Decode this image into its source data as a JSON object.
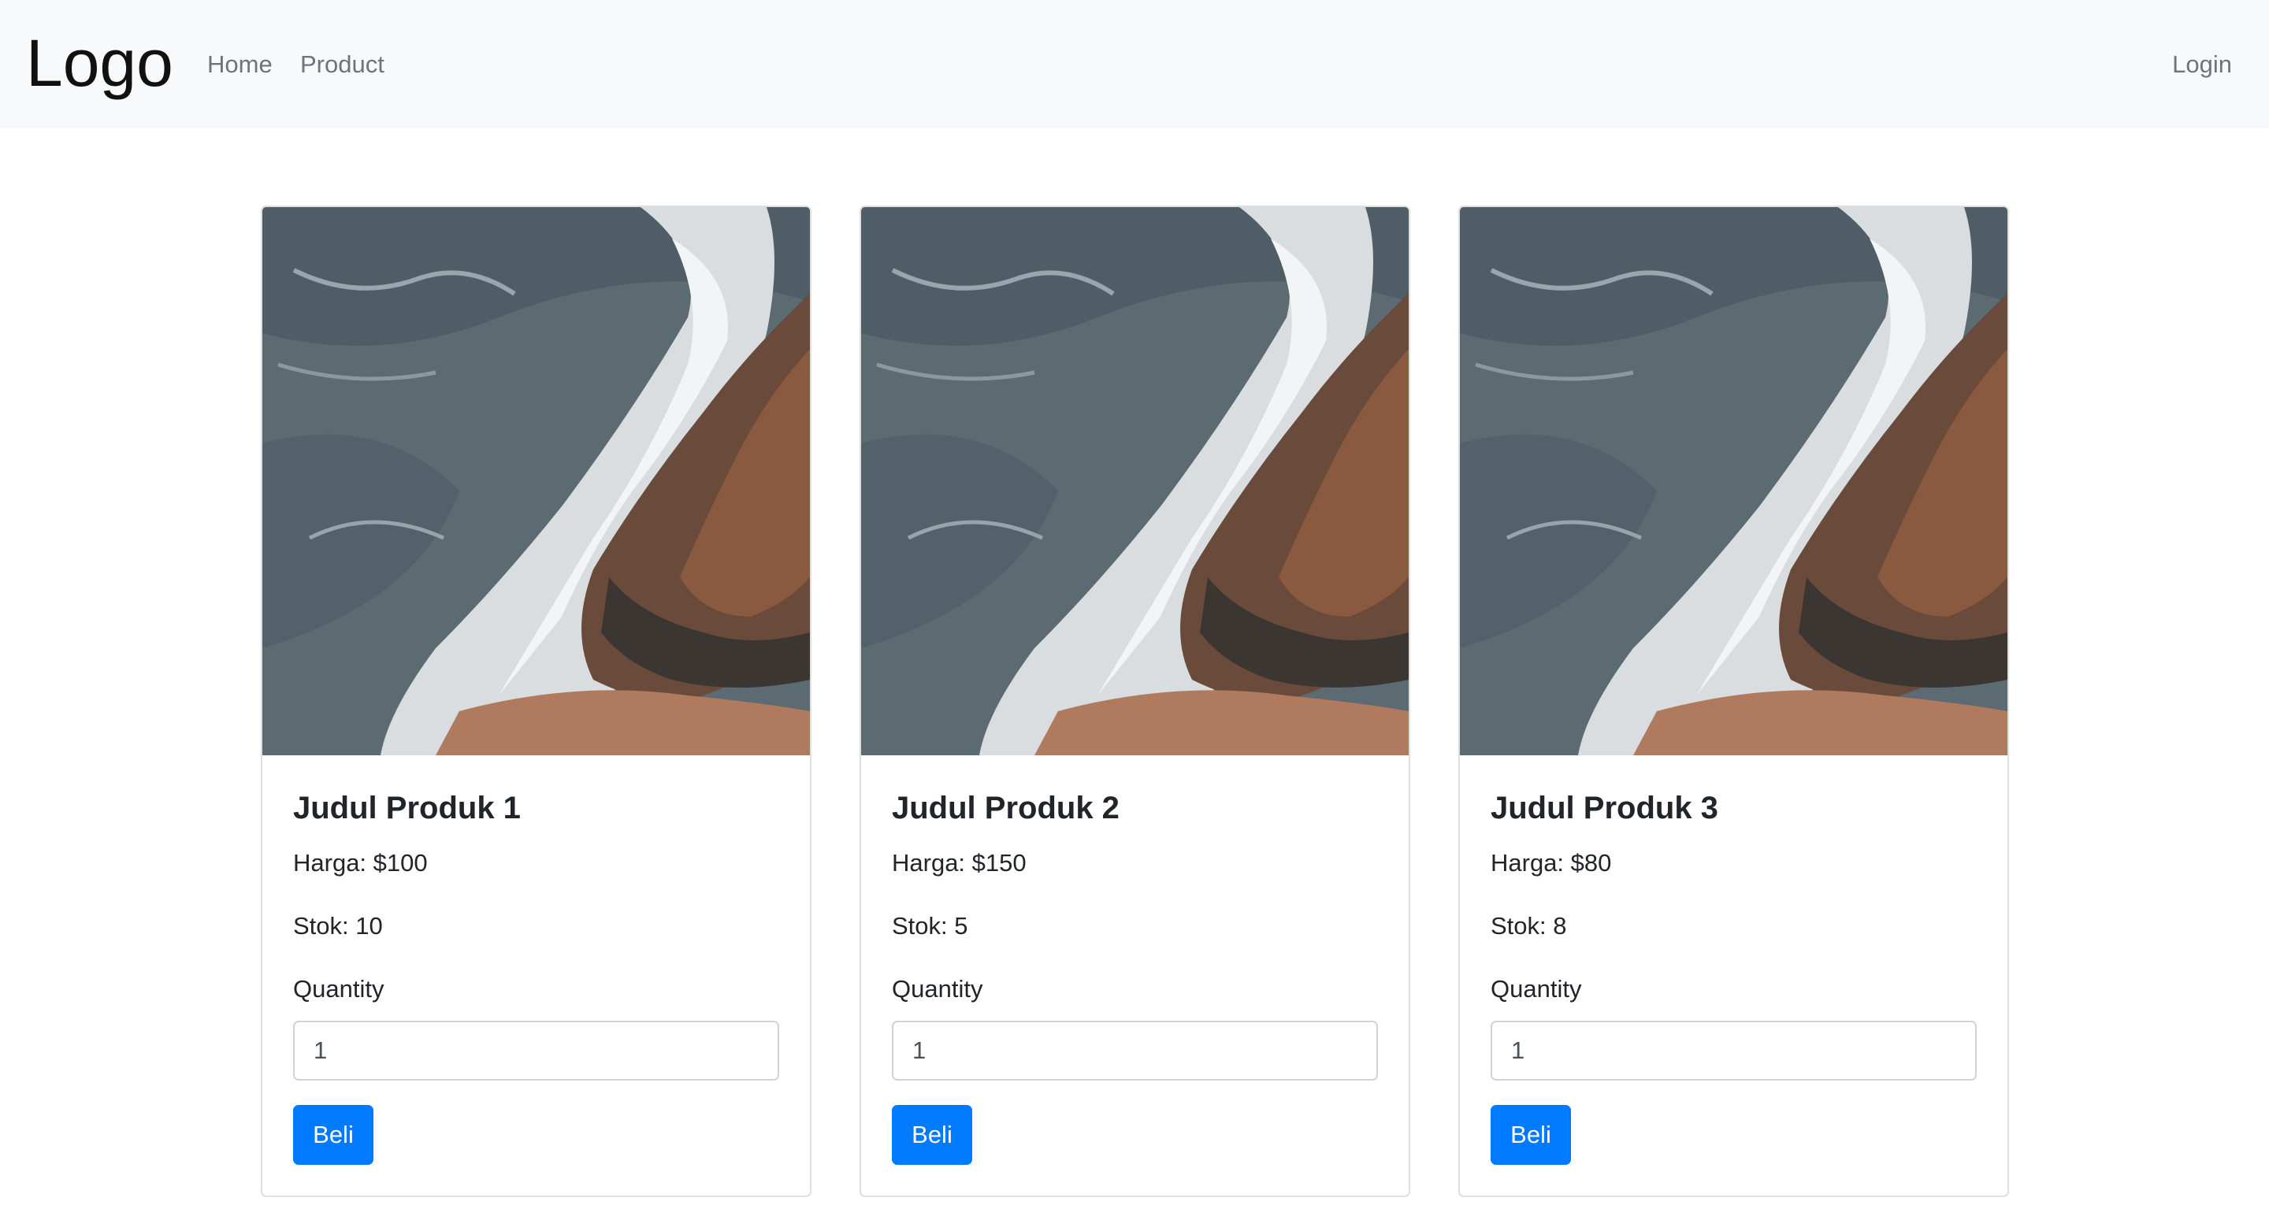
{
  "navbar": {
    "brand": "Logo",
    "links": [
      {
        "label": "Home"
      },
      {
        "label": "Product"
      }
    ],
    "login": "Login"
  },
  "products": [
    {
      "title": "Judul Produk 1",
      "harga": "Harga: $100",
      "stok": "Stok: 10",
      "quantity_label": "Quantity",
      "quantity_value": "1",
      "button": "Beli"
    },
    {
      "title": "Judul Produk 2",
      "harga": "Harga: $150",
      "stok": "Stok: 5",
      "quantity_label": "Quantity",
      "quantity_value": "1",
      "button": "Beli"
    },
    {
      "title": "Judul Produk 3",
      "harga": "Harga: $80",
      "stok": "Stok: 8",
      "quantity_label": "Quantity",
      "quantity_value": "1",
      "button": "Beli"
    }
  ],
  "colors": {
    "navbar_bg": "#f8f9fa",
    "primary_button": "#007bff",
    "nav_link": "#6c757d"
  }
}
